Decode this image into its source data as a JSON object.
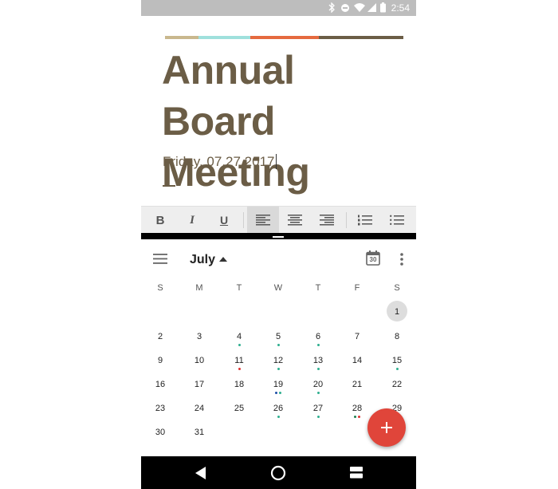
{
  "status_bar": {
    "time": "2:54",
    "icons": [
      "bluetooth-icon",
      "do-not-disturb-icon",
      "wifi-icon",
      "cell-signal-icon",
      "battery-icon"
    ]
  },
  "document": {
    "title": "Annual Board Meeting",
    "subtitle": "Friday, 07.27.2017",
    "stripe_colors": [
      "#c9b88e",
      "#9fe0dc",
      "#e56a3f",
      "#6b5d46"
    ],
    "text_color": "#6b5d46"
  },
  "toolbar": {
    "bold_label": "B",
    "italic_label": "I",
    "underline_label": "U",
    "buttons": [
      "bold",
      "italic",
      "underline",
      "align-left",
      "align-center",
      "align-right",
      "numbered-list",
      "bulleted-list"
    ],
    "active_button": "align-left"
  },
  "calendar": {
    "month": "July",
    "calendar_icon_day": "30",
    "weekdays": [
      "S",
      "M",
      "T",
      "W",
      "T",
      "F",
      "S"
    ],
    "selected_day": "1",
    "weeks": [
      [
        "",
        "",
        "",
        "",
        "",
        "",
        "1"
      ],
      [
        "2",
        "3",
        "4",
        "5",
        "6",
        "7",
        "8"
      ],
      [
        "9",
        "10",
        "11",
        "12",
        "13",
        "14",
        "15"
      ],
      [
        "16",
        "17",
        "18",
        "19",
        "20",
        "21",
        "22"
      ],
      [
        "23",
        "24",
        "25",
        "26",
        "27",
        "28",
        "29"
      ],
      [
        "30",
        "31",
        "",
        "",
        "",
        "",
        ""
      ]
    ],
    "event_colors": {
      "4": [
        "#2eaf8f"
      ],
      "5": [
        "#2eaf8f"
      ],
      "6": [
        "#2eaf8f"
      ],
      "11": [
        "#d33"
      ],
      "12": [
        "#2eaf8f"
      ],
      "13": [
        "#2eaf8f"
      ],
      "15": [
        "#2eaf8f"
      ],
      "19": [
        "#1e4fa8",
        "#2eaf8f"
      ],
      "20": [
        "#2eaf8f"
      ],
      "26": [
        "#2eaf8f"
      ],
      "27": [
        "#2eaf8f"
      ],
      "28": [
        "#1e7f4f",
        "#d33"
      ]
    }
  },
  "fab": {
    "icon": "plus-icon",
    "color": "#e0453a"
  },
  "nav_bar": {
    "buttons": [
      "back-icon",
      "home-icon",
      "recents-icon"
    ]
  }
}
